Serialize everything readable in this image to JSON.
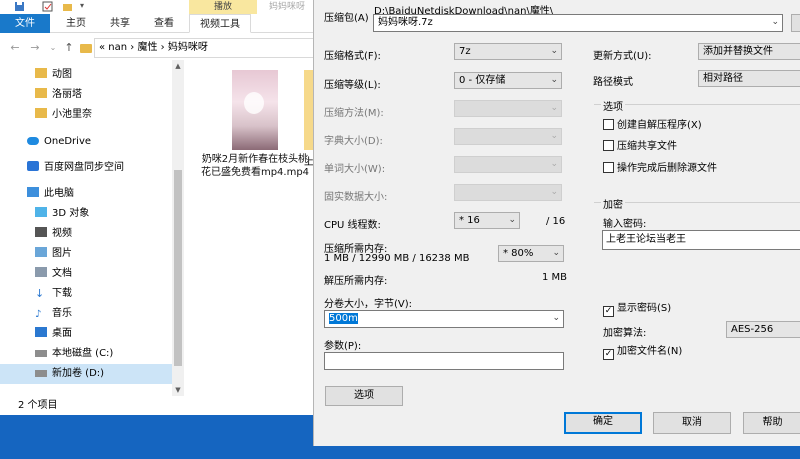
{
  "explorer": {
    "context_tab": "播放",
    "context_tab2": "妈妈咪呀",
    "ribbon_tabs": [
      "文件",
      "主页",
      "共享",
      "查看",
      "视频工具"
    ],
    "breadcrumb": "«  nan  ›  魔性  ›  妈妈咪呀",
    "nav_items": [
      {
        "label": "动图",
        "icon": "folder-icon"
      },
      {
        "label": "洛丽塔",
        "icon": "folder-icon"
      },
      {
        "label": "小池里奈",
        "icon": "folder-icon"
      },
      {
        "label": "OneDrive",
        "icon": "cloud-icon"
      },
      {
        "label": "百度网盘同步空间",
        "icon": "baidu-sync-icon"
      },
      {
        "label": "此电脑",
        "icon": "computer-icon"
      },
      {
        "label": "3D 对象",
        "icon": "3d-objects-icon"
      },
      {
        "label": "视频",
        "icon": "video-icon"
      },
      {
        "label": "图片",
        "icon": "pictures-icon"
      },
      {
        "label": "文档",
        "icon": "documents-icon"
      },
      {
        "label": "下载",
        "icon": "download-icon"
      },
      {
        "label": "音乐",
        "icon": "music-icon"
      },
      {
        "label": "桌面",
        "icon": "desktop-icon"
      },
      {
        "label": "本地磁盘 (C:)",
        "icon": "drive-icon"
      },
      {
        "label": "新加卷 (D:)",
        "icon": "drive-icon"
      }
    ],
    "files": [
      {
        "name": "奶咪2月新作春在枝头桃花已盛免费看mp4.mp4"
      },
      {
        "name": "上专"
      }
    ],
    "status": "2 个项目"
  },
  "dialog": {
    "archive_label": "压缩包(A)",
    "archive_path": "D:\\BaiduNetdiskDownload\\nan\\魔性\\",
    "archive_name": "妈妈咪呀.7z",
    "format_label": "压缩格式(F):",
    "format_value": "7z",
    "level_label": "压缩等级(L):",
    "level_value": "0 - 仅存储",
    "method_label": "压缩方法(M):",
    "dict_label": "字典大小(D):",
    "word_label": "单词大小(W):",
    "solid_label": "固实数据大小:",
    "cpu_label": "CPU 线程数:",
    "cpu_value": "* 16",
    "cpu_total": "/ 16",
    "mem_label": "压缩所需内存:",
    "mem_detail": "1 MB / 12990 MB / 16238 MB",
    "mem_percent": "* 80%",
    "decomp_mem_label": "解压所需内存:",
    "decomp_mem_value": "1 MB",
    "volume_label": "分卷大小，字节(V):",
    "volume_value": "500m",
    "params_label": "参数(P):",
    "params_value": "",
    "options_button": "选项",
    "update_label": "更新方式(U):",
    "update_value": "添加并替换文件",
    "path_label": "路径模式",
    "path_value": "相对路径",
    "options_group": "选项",
    "opt_sfx": "创建自解压程序(X)",
    "opt_shared": "压缩共享文件",
    "opt_delete": "操作完成后删除源文件",
    "encrypt_group": "加密",
    "password_label": "输入密码:",
    "password_value": "上老王论坛当老王",
    "show_password": "显示密码(S)",
    "enc_method_label": "加密算法:",
    "enc_method_value": "AES-256",
    "encrypt_names": "加密文件名(N)",
    "ok": "确定",
    "cancel": "取消",
    "help": "帮助"
  }
}
